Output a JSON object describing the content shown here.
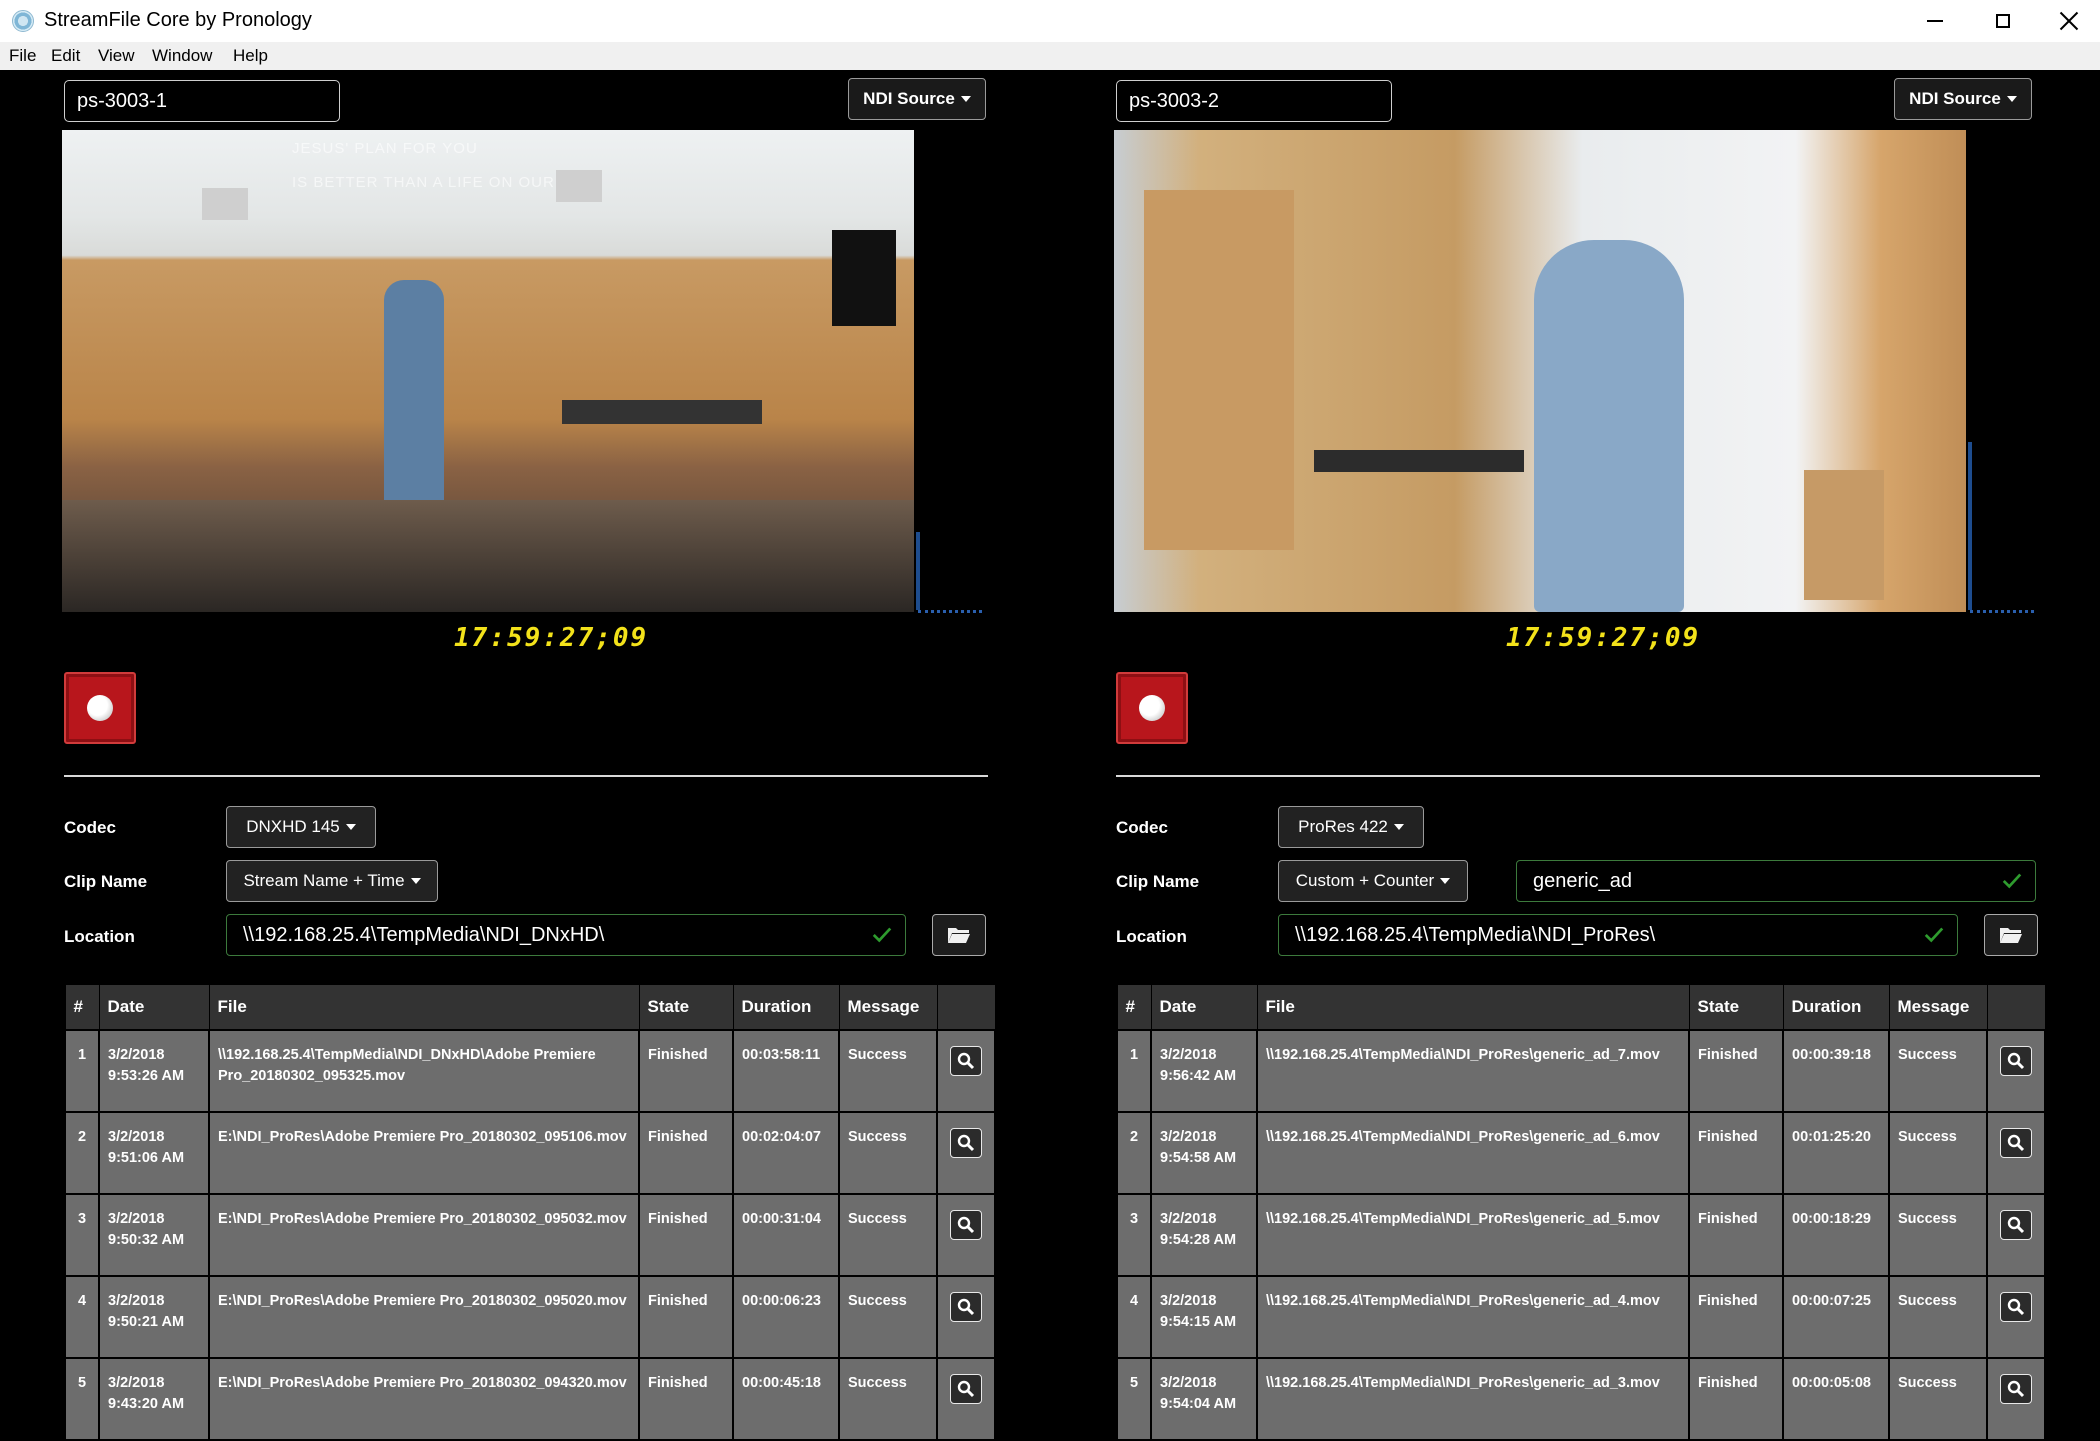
{
  "window": {
    "title": "StreamFile Core by Pronology"
  },
  "menu": [
    "File",
    "Edit",
    "View",
    "Window",
    "Help"
  ],
  "icons": {
    "app": "streamfile-app-icon",
    "minimize": "minimize-icon",
    "maximize": "maximize-icon",
    "close": "close-icon",
    "record": "record-icon",
    "folder": "folder-icon",
    "search": "search-icon",
    "check": "checkmark-icon",
    "caret": "caret-down-icon"
  },
  "colors": {
    "background": "#000000",
    "timecode": "#f3e21a",
    "record": "#b8161c",
    "valid": "#2e9b2e",
    "table_header": "#333333",
    "table_row": "#6d6d6d"
  },
  "table_headers": [
    "#",
    "Date",
    "File",
    "State",
    "Duration",
    "Message",
    ""
  ],
  "panels": [
    {
      "name": "ps-3003-1",
      "source_label": "NDI Source",
      "timecode": "17:59:27;09",
      "wall_text_1": "JESUS' PLAN FOR YOU",
      "wall_text_2": "IS BETTER THAN A LIFE ON OUR OWN",
      "codec_label": "Codec",
      "codec_value": "DNXHD 145",
      "clipname_label": "Clip Name",
      "clipname_value": "Stream Name + Time",
      "custom_name": "",
      "location_label": "Location",
      "location_value": "\\\\192.168.25.4\\TempMedia\\NDI_DNxHD\\",
      "rows": [
        {
          "num": "1",
          "date": "3/2/2018",
          "time": "9:53:26 AM",
          "file": "\\\\192.168.25.4\\TempMedia\\NDI_DNxHD\\Adobe Premiere Pro_20180302_095325.mov",
          "state": "Finished",
          "duration": "00:03:58:11",
          "message": "Success"
        },
        {
          "num": "2",
          "date": "3/2/2018",
          "time": "9:51:06 AM",
          "file": "E:\\NDI_ProRes\\Adobe Premiere Pro_20180302_095106.mov",
          "state": "Finished",
          "duration": "00:02:04:07",
          "message": "Success"
        },
        {
          "num": "3",
          "date": "3/2/2018",
          "time": "9:50:32 AM",
          "file": "E:\\NDI_ProRes\\Adobe Premiere Pro_20180302_095032.mov",
          "state": "Finished",
          "duration": "00:00:31:04",
          "message": "Success"
        },
        {
          "num": "4",
          "date": "3/2/2018",
          "time": "9:50:21 AM",
          "file": "E:\\NDI_ProRes\\Adobe Premiere Pro_20180302_095020.mov",
          "state": "Finished",
          "duration": "00:00:06:23",
          "message": "Success"
        },
        {
          "num": "5",
          "date": "3/2/2018",
          "time": "9:43:20 AM",
          "file": "E:\\NDI_ProRes\\Adobe Premiere Pro_20180302_094320.mov",
          "state": "Finished",
          "duration": "00:00:45:18",
          "message": "Success"
        }
      ]
    },
    {
      "name": "ps-3003-2",
      "source_label": "NDI Source",
      "timecode": "17:59:27;09",
      "wall_text_1": "",
      "wall_text_2": "",
      "codec_label": "Codec",
      "codec_value": "ProRes 422",
      "clipname_label": "Clip Name",
      "clipname_value": "Custom + Counter",
      "custom_name": "generic_ad",
      "location_label": "Location",
      "location_value": "\\\\192.168.25.4\\TempMedia\\NDI_ProRes\\",
      "rows": [
        {
          "num": "1",
          "date": "3/2/2018",
          "time": "9:56:42 AM",
          "file": "\\\\192.168.25.4\\TempMedia\\NDI_ProRes\\generic_ad_7.mov",
          "state": "Finished",
          "duration": "00:00:39:18",
          "message": "Success"
        },
        {
          "num": "2",
          "date": "3/2/2018",
          "time": "9:54:58 AM",
          "file": "\\\\192.168.25.4\\TempMedia\\NDI_ProRes\\generic_ad_6.mov",
          "state": "Finished",
          "duration": "00:01:25:20",
          "message": "Success"
        },
        {
          "num": "3",
          "date": "3/2/2018",
          "time": "9:54:28 AM",
          "file": "\\\\192.168.25.4\\TempMedia\\NDI_ProRes\\generic_ad_5.mov",
          "state": "Finished",
          "duration": "00:00:18:29",
          "message": "Success"
        },
        {
          "num": "4",
          "date": "3/2/2018",
          "time": "9:54:15 AM",
          "file": "\\\\192.168.25.4\\TempMedia\\NDI_ProRes\\generic_ad_4.mov",
          "state": "Finished",
          "duration": "00:00:07:25",
          "message": "Success"
        },
        {
          "num": "5",
          "date": "3/2/2018",
          "time": "9:54:04 AM",
          "file": "\\\\192.168.25.4\\TempMedia\\NDI_ProRes\\generic_ad_3.mov",
          "state": "Finished",
          "duration": "00:00:05:08",
          "message": "Success"
        }
      ]
    }
  ]
}
